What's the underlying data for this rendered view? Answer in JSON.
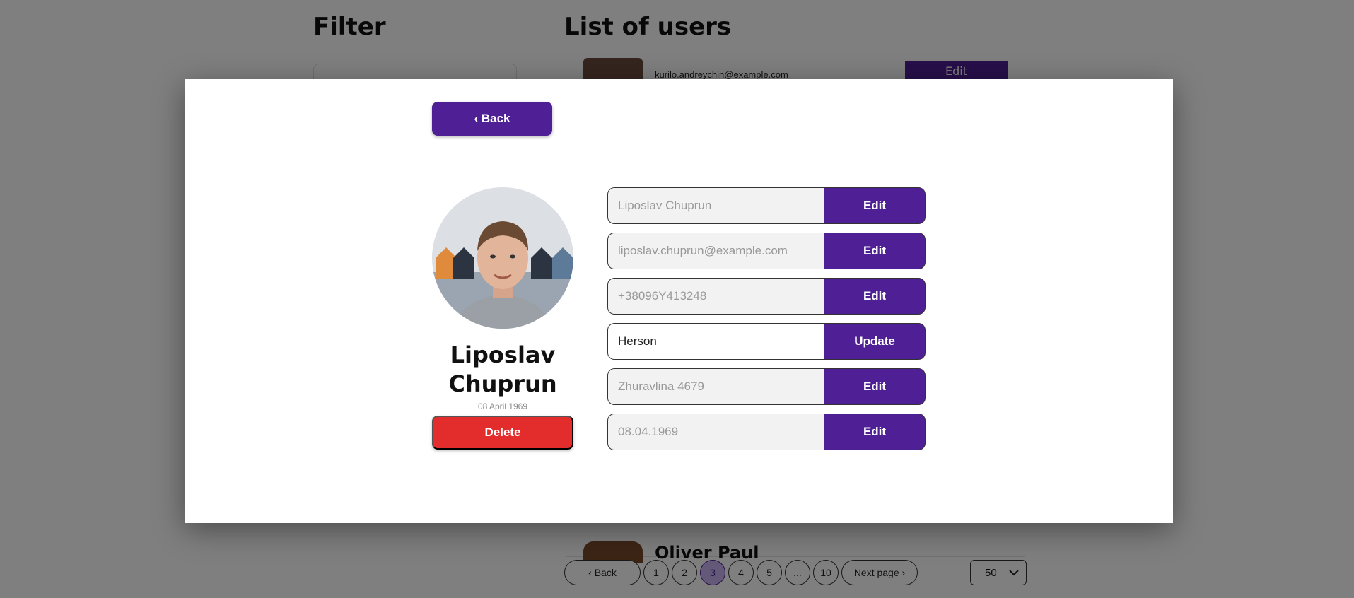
{
  "background": {
    "filter_title": "Filter",
    "list_title": "List of users",
    "row_email": "kurilo.andreychin@example.com",
    "row_edit": "Edit",
    "row2_name": "Oliver Paul",
    "pagination": {
      "back": "‹ Back",
      "pages": [
        "1",
        "2",
        "3",
        "4",
        "5",
        "...",
        "10"
      ],
      "active_page": "3",
      "next": "Next page ›"
    },
    "per_page": "50"
  },
  "modal": {
    "back_label": "‹ Back",
    "user": {
      "first_name": "Liposlav",
      "last_name": "Chuprun",
      "dob_display": "08 April 1969"
    },
    "delete_label": "Delete",
    "fields": [
      {
        "value": "Liposlav Chuprun",
        "button": "Edit"
      },
      {
        "value": "liposlav.chuprun@example.com",
        "button": "Edit"
      },
      {
        "value": "+38096Y413248",
        "button": "Edit"
      },
      {
        "value": "Herson",
        "button": "Update"
      },
      {
        "value": "Zhuravlina 4679",
        "button": "Edit"
      },
      {
        "value": "08.04.1969",
        "button": "Edit"
      }
    ]
  },
  "colors": {
    "accent": "#4f1f95",
    "danger": "#e32c2c",
    "active_page_bg": "#c9b3f2"
  }
}
